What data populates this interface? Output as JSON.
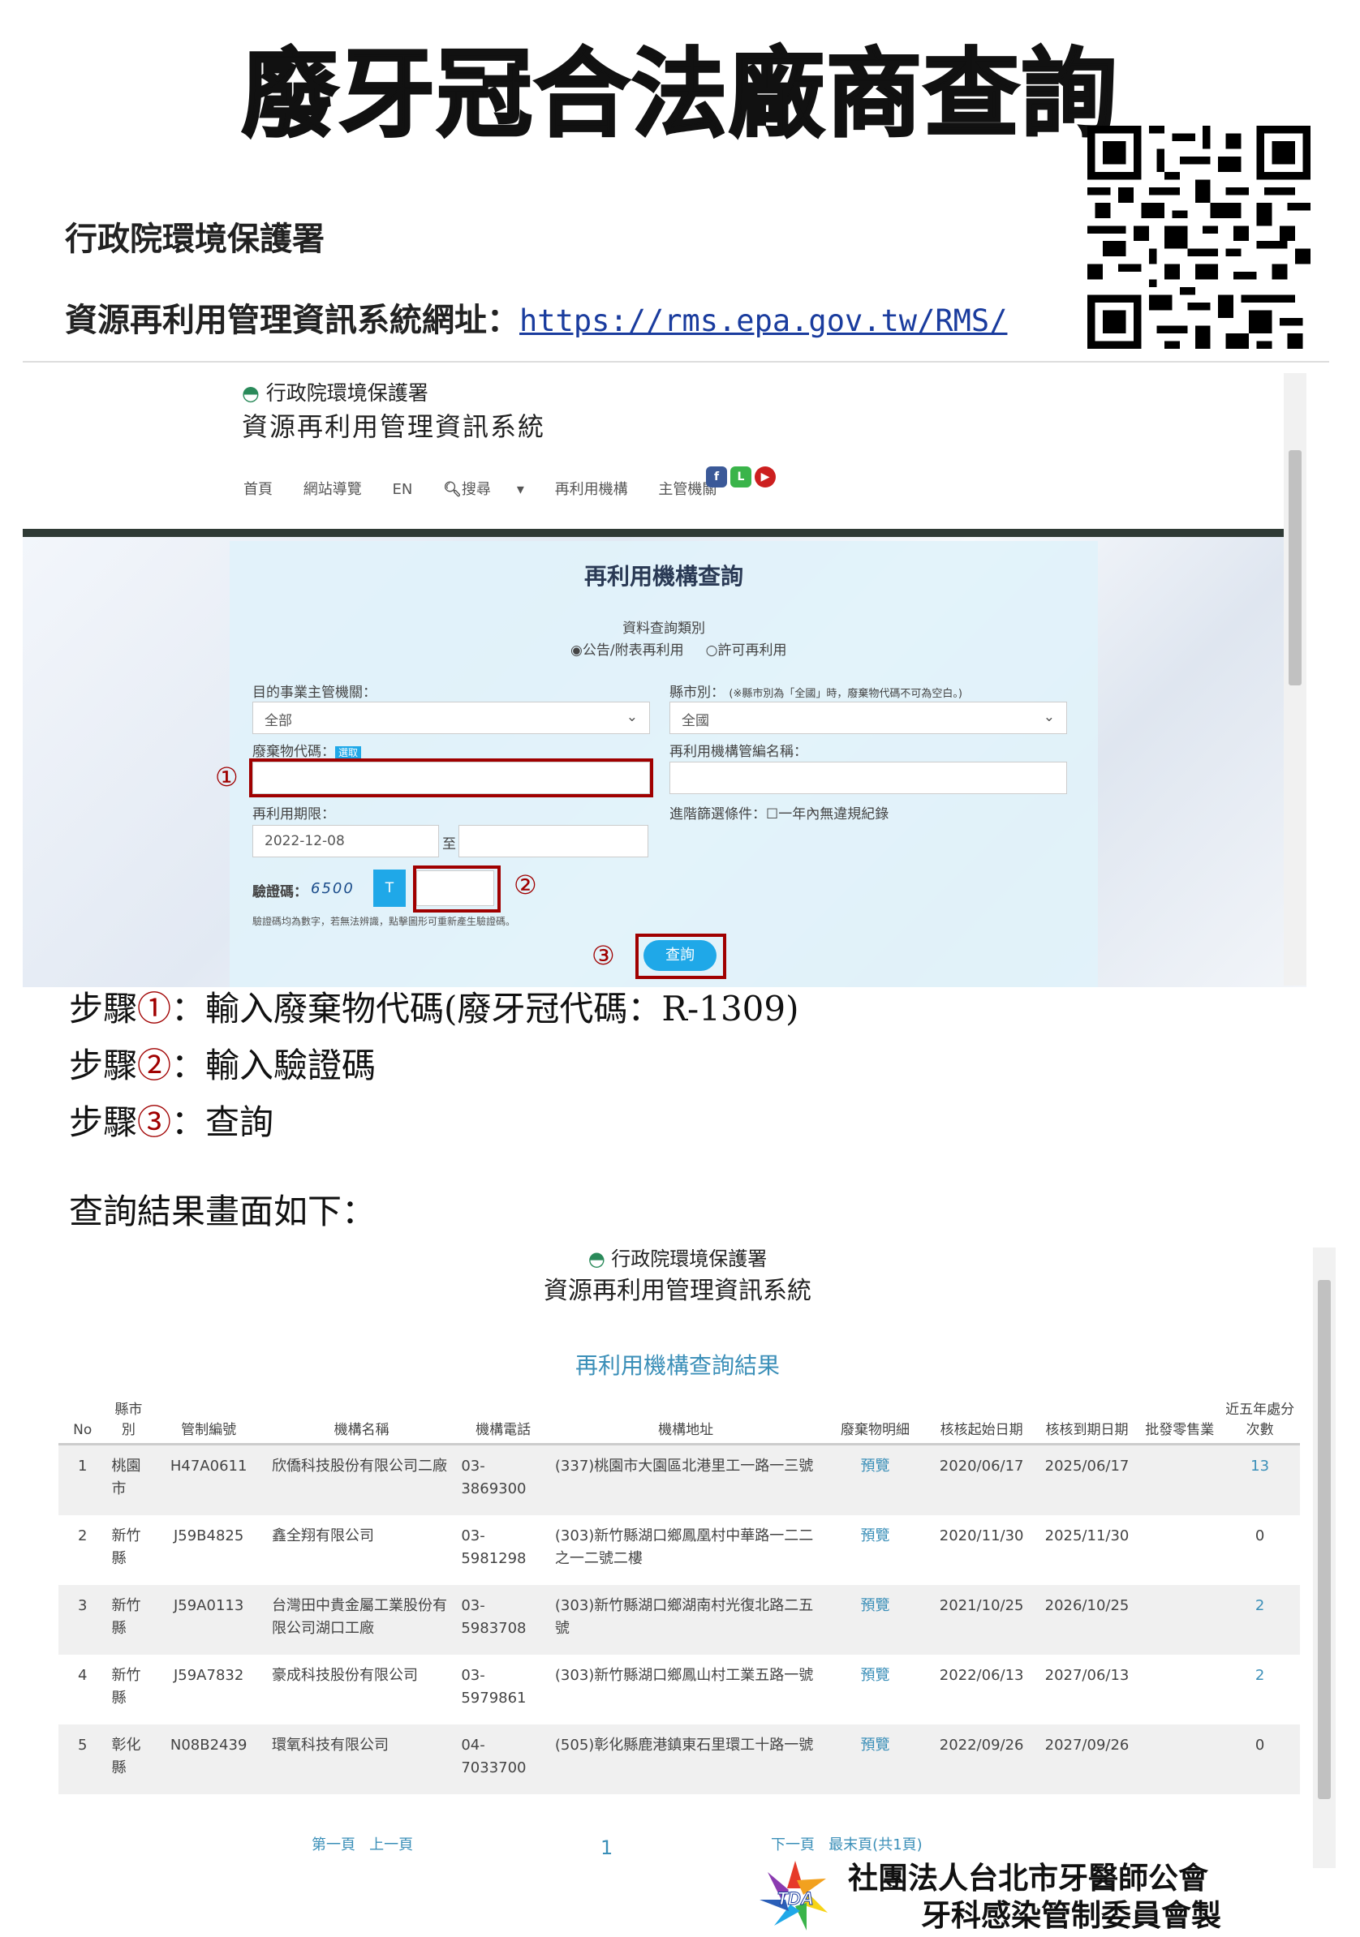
{
  "title": "廢牙冠合法廠商查詢",
  "agency": "行政院環境保護署",
  "url_line": {
    "label": "資源再利用管理資訊系統網址：",
    "url": "https://rms.epa.gov.tw/RMS/"
  },
  "screenshot1": {
    "header": {
      "logo_text": "行政院環境保護署",
      "system_name": "資源再利用管理資訊系統"
    },
    "nav": [
      "首頁",
      "網站導覽",
      "EN",
      "搜尋",
      "再利用機構",
      "主管機關"
    ],
    "panel_title": "再利用機構查詢",
    "query_type_label": "資料查詢類別",
    "radio_options": [
      "公告/附表再利用",
      "許可再利用"
    ],
    "authority_label": "目的事業主管機關：",
    "authority_value": "全部",
    "county_label": "縣市別：",
    "county_note": "(※縣市別為「全國」時，廢棄物代碼不可為空白。)",
    "county_value": "全國",
    "waste_code_label": "廢棄物代碼：",
    "waste_code_tag": "選取",
    "org_label": "再利用機構管編名稱：",
    "period_label": "再利用期限：",
    "period_start": "2022-12-08",
    "period_to": "至",
    "advanced_label": "進階篩選條件：",
    "advanced_option": "一年內無違規紀錄",
    "captcha_label": "驗證碼：",
    "captcha_value": "6500",
    "captcha_refresh": "T",
    "captcha_note": "驗證碼均為數字，若無法辨識，點擊圖形可重新產生驗證碼。",
    "search_button": "查詢",
    "markers": [
      "①",
      "②",
      "③"
    ]
  },
  "steps": [
    {
      "prefix": "步驟",
      "num": "①",
      "text": "：輸入廢棄物代碼(廢牙冠代碼：R-1309)"
    },
    {
      "prefix": "步驟",
      "num": "②",
      "text": "：輸入驗證碼"
    },
    {
      "prefix": "步驟",
      "num": "③",
      "text": "：查詢"
    }
  ],
  "results_intro": "查詢結果畫面如下：",
  "screenshot2": {
    "logo_text": "行政院環境保護署",
    "system_name": "資源再利用管理資訊系統",
    "title": "再利用機構查詢結果",
    "columns": [
      "No",
      "縣市別",
      "管制編號",
      "機構名稱",
      "機構電話",
      "機構地址",
      "廢棄物明細",
      "核核起始日期",
      "核核到期日期",
      "批發零售業",
      "近五年處分次數"
    ],
    "rows": [
      [
        "1",
        "桃園市",
        "H47A0611",
        "欣僑科技股份有限公司二廠",
        "03-3869300",
        "(337)桃園市大園區北港里工一路一三號",
        "預覽",
        "2020/06/17",
        "2025/06/17",
        "",
        "13"
      ],
      [
        "2",
        "新竹縣",
        "J59B4825",
        "鑫全翔有限公司",
        "03-5981298",
        "(303)新竹縣湖口鄉鳳凰村中華路一二二之一二號二樓",
        "預覽",
        "2020/11/30",
        "2025/11/30",
        "",
        "0"
      ],
      [
        "3",
        "新竹縣",
        "J59A0113",
        "台灣田中貴金屬工業股份有限公司湖口工廠",
        "03-5983708",
        "(303)新竹縣湖口鄉湖南村光復北路二五號",
        "預覽",
        "2021/10/25",
        "2026/10/25",
        "",
        "2"
      ],
      [
        "4",
        "新竹縣",
        "J59A7832",
        "豪成科技股份有限公司",
        "03-5979861",
        "(303)新竹縣湖口鄉鳳山村工業五路一號",
        "預覽",
        "2022/06/13",
        "2027/06/13",
        "",
        "2"
      ],
      [
        "5",
        "彰化縣",
        "N08B2439",
        "環氧科技有限公司",
        "04-7033700",
        "(505)彰化縣鹿港鎮東石里環工十路一號",
        "預覽",
        "2022/09/26",
        "2027/09/26",
        "",
        "0"
      ]
    ],
    "pager": {
      "first": "第一頁",
      "prev": "上一頁",
      "current": "1",
      "next": "下一頁",
      "last": "最末頁(共1頁)"
    }
  },
  "footer": {
    "logo_text": "TDA",
    "org_line1": "社團法人台北市牙醫師公會",
    "org_line2": "牙科感染管制委員會製"
  }
}
